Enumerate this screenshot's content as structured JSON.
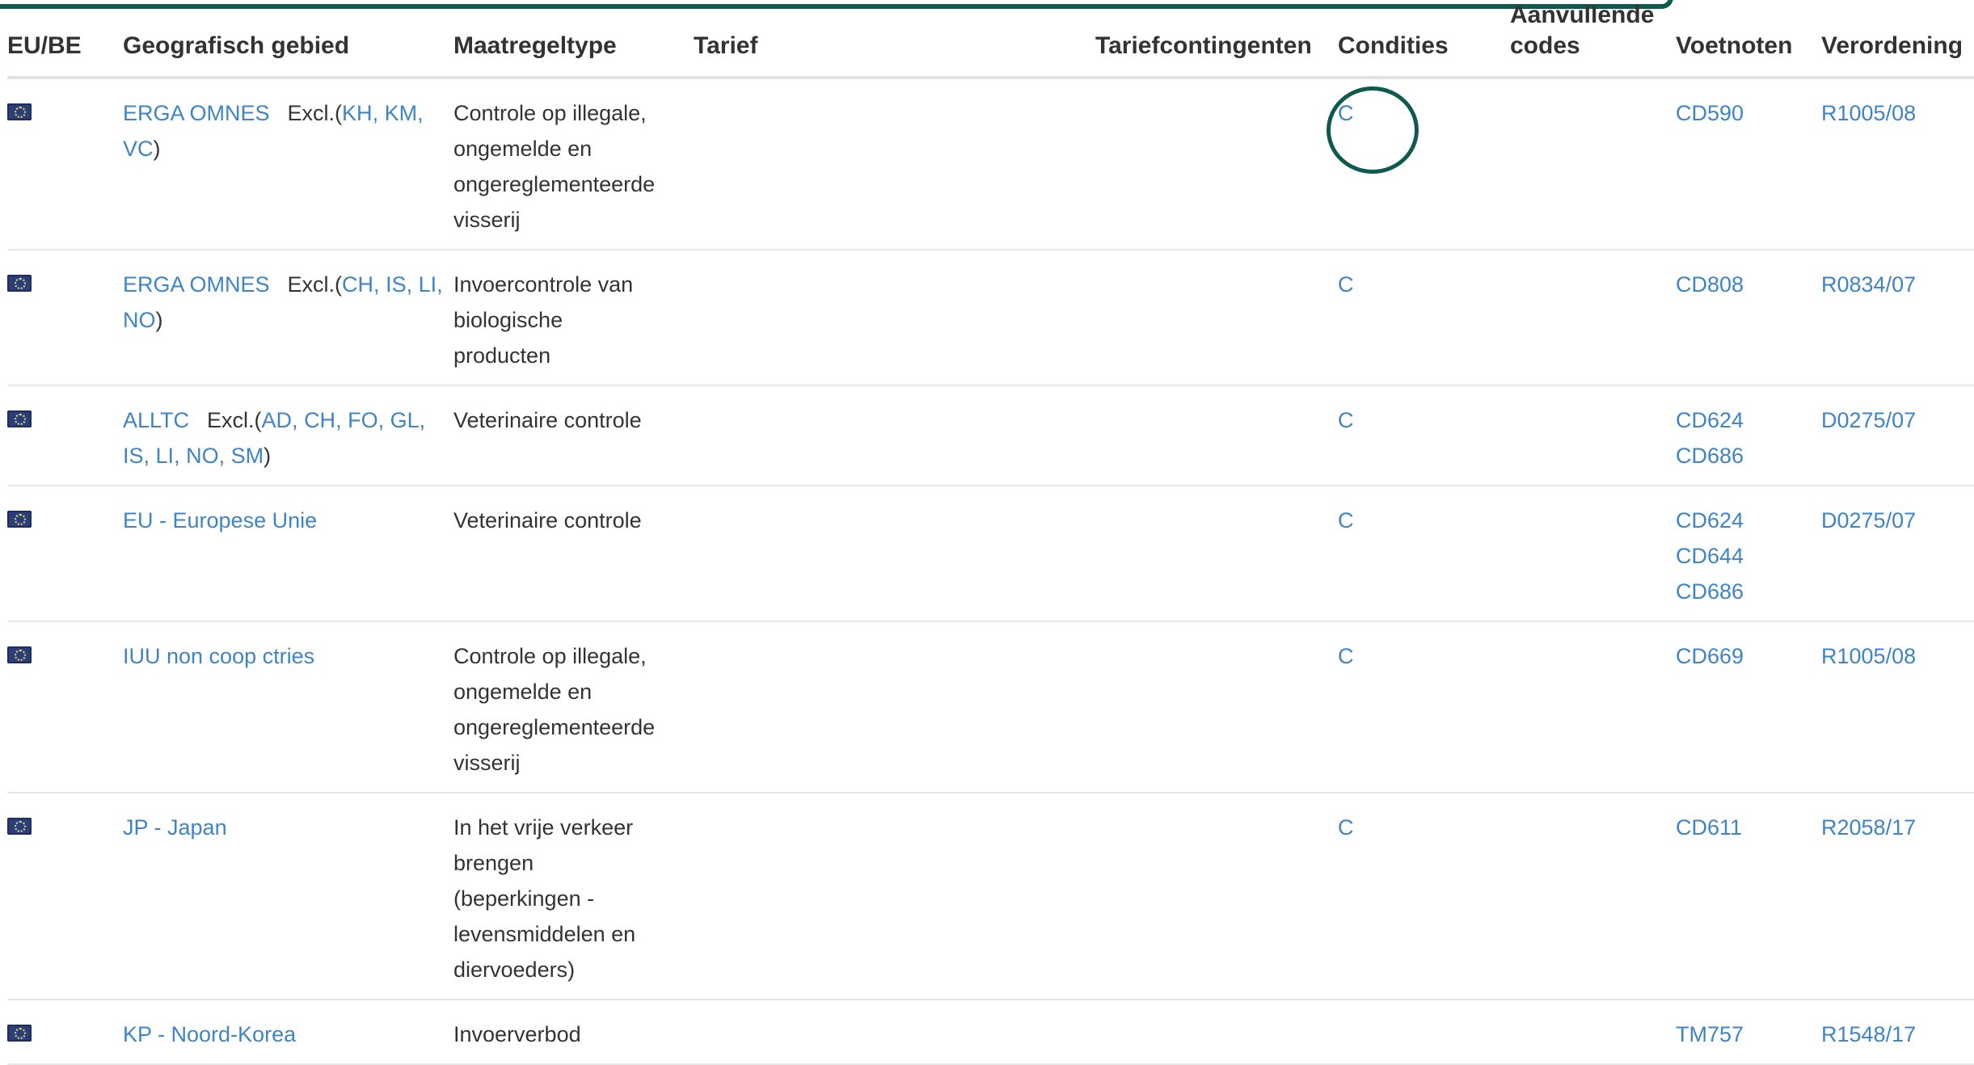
{
  "columns": {
    "eu_be": "EU/BE",
    "geo": "Geografisch gebied",
    "type": "Maatregeltype",
    "tarief": "Tarief",
    "tariefcontingenten": "Tariefcontingenten",
    "condities": "Condities",
    "aanvullende_1": "Aanvullende",
    "aanvullende_2": "codes",
    "voetnoten": "Voetnoten",
    "verordening": "Verordening"
  },
  "excl_label": "Excl.(",
  "excl_close": ")",
  "rows": [
    {
      "geo": "ERGA OMNES",
      "excl": [
        "KH",
        "KM",
        "VC"
      ],
      "type": [
        "Controle op illegale,",
        "ongemelde en",
        "ongereglementeerde",
        "visserij"
      ],
      "condition": "C",
      "footnotes": [
        "CD590"
      ],
      "regulation": "R1005/08"
    },
    {
      "geo": "ERGA OMNES",
      "excl": [
        "CH",
        "IS",
        "LI",
        "NO"
      ],
      "type": [
        "Invoercontrole van",
        "biologische",
        "producten"
      ],
      "condition": "C",
      "footnotes": [
        "CD808"
      ],
      "regulation": "R0834/07"
    },
    {
      "geo": "ALLTC",
      "excl": [
        "AD",
        "CH",
        "FO",
        "GL",
        "IS",
        "LI",
        "NO",
        "SM"
      ],
      "type": [
        "Veterinaire controle"
      ],
      "condition": "C",
      "footnotes": [
        "CD624",
        "CD686"
      ],
      "regulation": "D0275/07"
    },
    {
      "geo": "EU - Europese Unie",
      "excl": [],
      "type": [
        "Veterinaire controle"
      ],
      "condition": "C",
      "footnotes": [
        "CD624",
        "CD644",
        "CD686"
      ],
      "regulation": "D0275/07"
    },
    {
      "geo": "IUU non coop ctries",
      "excl": [],
      "type": [
        "Controle op illegale,",
        "ongemelde en",
        "ongereglementeerde",
        "visserij"
      ],
      "condition": "C",
      "footnotes": [
        "CD669"
      ],
      "regulation": "R1005/08"
    },
    {
      "geo": "JP - Japan",
      "excl": [],
      "type": [
        "In het vrije verkeer",
        "brengen",
        "(beperkingen -",
        "levensmiddelen en",
        "diervoeders)"
      ],
      "condition": "C",
      "footnotes": [
        "CD611"
      ],
      "regulation": "R2058/17"
    },
    {
      "geo": "KP - Noord-Korea",
      "excl": [],
      "type": [
        "Invoerverbod"
      ],
      "condition": "",
      "footnotes": [
        "TM757"
      ],
      "regulation": "R1548/17"
    }
  ],
  "colors": {
    "link": "#3f84c6",
    "text": "#333333",
    "highlight": "#0e5a4e",
    "flag": "#2a3f7a"
  },
  "icons": {
    "flag": "eu-flag-icon"
  }
}
